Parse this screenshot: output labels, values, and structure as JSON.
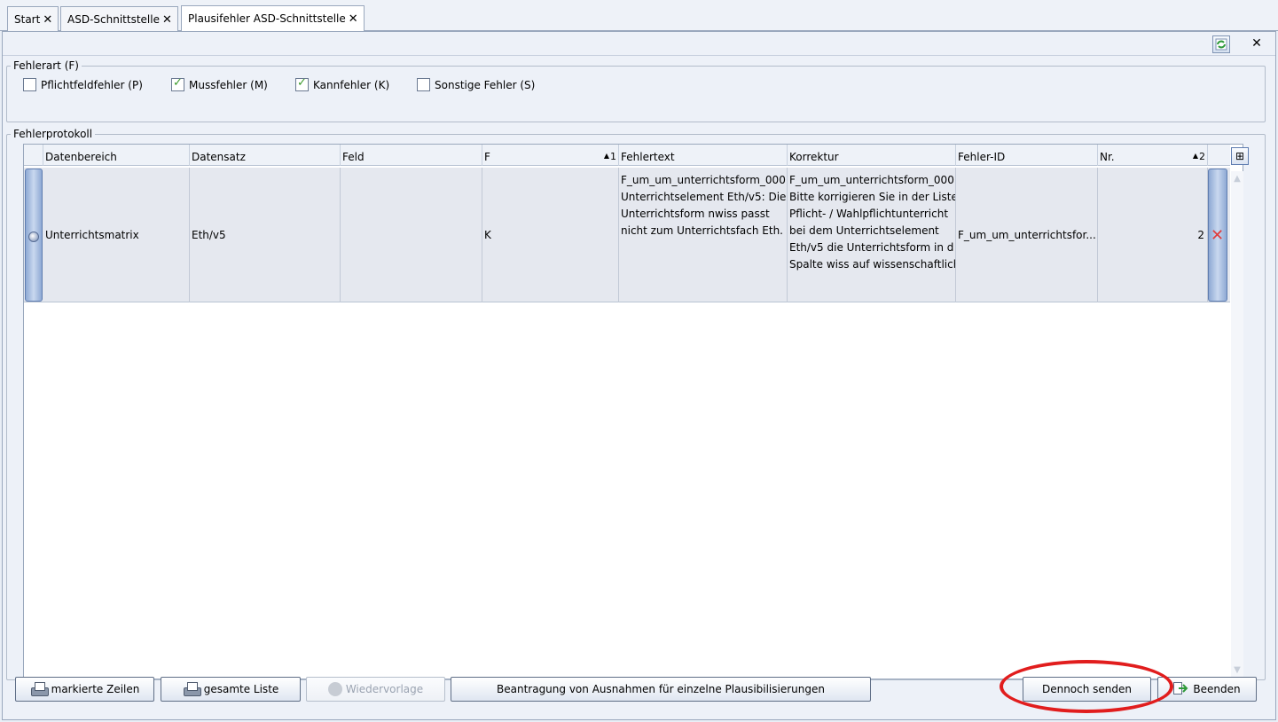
{
  "tabs": [
    {
      "label": "Start",
      "close": "✕"
    },
    {
      "label": "ASD-Schnittstelle",
      "close": "✕"
    },
    {
      "label": "Plausifehler ASD-Schnittstelle",
      "close": "✕"
    }
  ],
  "toolbar": {
    "close_label": "✕"
  },
  "fehlerart": {
    "legend": "Fehlerart (F)",
    "options": [
      {
        "label": "Pflichtfeldfehler (P)",
        "checked": false
      },
      {
        "label": "Mussfehler (M)",
        "checked": true
      },
      {
        "label": "Kannfehler (K)",
        "checked": true
      },
      {
        "label": "Sonstige Fehler (S)",
        "checked": false
      }
    ]
  },
  "protokoll": {
    "legend": "Fehlerprotokoll",
    "columns": {
      "datenbereich": "Datenbereich",
      "datensatz": "Datensatz",
      "feld": "Feld",
      "f": "F",
      "f_sort": "1",
      "fehlertext": "Fehlertext",
      "korrektur": "Korrektur",
      "fehler_id": "Fehler-ID",
      "nr": "Nr.",
      "nr_sort": "2"
    },
    "rows": [
      {
        "datenbereich": "Unterrichtsmatrix",
        "datensatz": "Eth/v5",
        "feld": "",
        "f": "K",
        "fehlertext": [
          "F_um_um_unterrichtsform_000",
          "Unterrichtselement Eth/v5: Die",
          "Unterrichtsform nwiss passt",
          "nicht zum Unterrichtsfach Eth."
        ],
        "korrektur": [
          "F_um_um_unterrichtsform_000",
          "Bitte korrigieren Sie in der Liste",
          "Pflicht- / Wahlpflichtunterricht",
          "bei dem Unterrichtselement",
          "Eth/v5 die Unterrichtsform in d",
          "Spalte wiss auf wissenschaftlich"
        ],
        "fehler_id": "F_um_um_unterrichtsfor...",
        "nr": "2"
      }
    ]
  },
  "buttons": {
    "markierte_zeilen": "markierte Zeilen",
    "gesamte_liste": "gesamte Liste",
    "wiedervorlage": "Wiedervorlage",
    "beantragung": "Beantragung von Ausnahmen für einzelne Plausibilisierungen",
    "dennoch_senden": "Dennoch senden",
    "beenden": "Beenden"
  },
  "colors": {
    "highlight": "#e11d1d",
    "check": "#3c9a2c",
    "delete": "#e03c3c"
  }
}
